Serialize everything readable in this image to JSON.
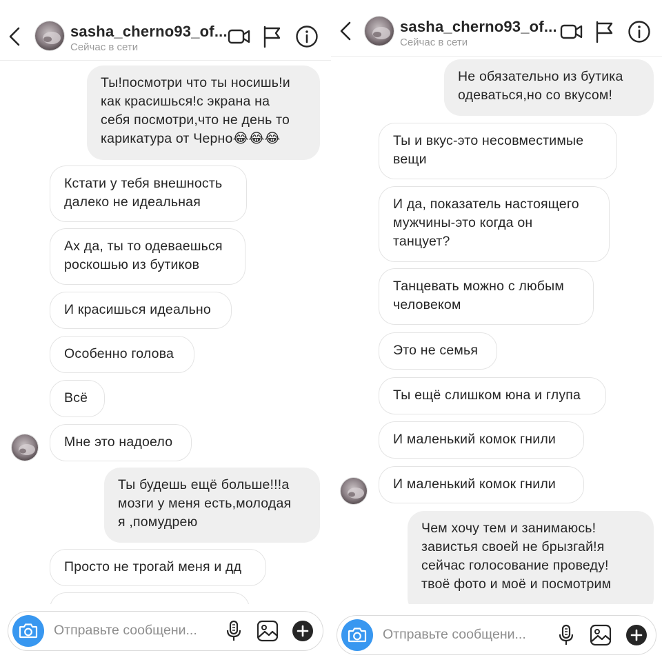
{
  "left": {
    "header": {
      "name": "sasha_cherno93_of...",
      "status": "Сейчас в сети"
    },
    "messages": [
      {
        "dir": "out",
        "text": "Ты!посмотри что ты носишь!и\nкак красишься!с экрана на\nсебя посмотри,что не день то\nкарикатура от Черно😂😂😂"
      },
      {
        "dir": "in",
        "text": "Кстати у тебя внешность\nдалеко не идеальная"
      },
      {
        "dir": "in",
        "text": "Ах да, ты то одеваешься\nроскошью из бутиков"
      },
      {
        "dir": "in",
        "text": "И красишься идеально"
      },
      {
        "dir": "in",
        "text": "Особенно голова"
      },
      {
        "dir": "in",
        "text": "Всё"
      },
      {
        "dir": "in",
        "text": "Мне это надоело"
      },
      {
        "dir": "out",
        "text": "Ты будешь ещё больше!!!а\nмозги у меня есть,молодая\nя ,помудрею"
      },
      {
        "dir": "in",
        "text": "Просто не трогай меня и дд"
      }
    ],
    "composer": {
      "placeholder": "Отправьте сообщени..."
    }
  },
  "right": {
    "header": {
      "name": "sasha_cherno93_of...",
      "status": "Сейчас в сети"
    },
    "messages": [
      {
        "dir": "out",
        "text": "Не обязательно из бутика\nодеваться,но со вкусом!"
      },
      {
        "dir": "in",
        "text": "Ты и вкус-это несовместимые\nвещи"
      },
      {
        "dir": "in",
        "text": "И да, показатель настоящего\nмужчины-это когда он\nтанцует?"
      },
      {
        "dir": "in",
        "text": "Танцевать можно с любым\nчеловеком"
      },
      {
        "dir": "in",
        "text": "Это не семья"
      },
      {
        "dir": "in",
        "text": "Ты ещё слишком юна и глупа"
      },
      {
        "dir": "in",
        "text": "И маленький комок гнили"
      },
      {
        "dir": "in",
        "text": "И маленький комок гнили"
      },
      {
        "dir": "out",
        "text": "Чем хочу тем и занимаюсь!\nзавистья своей не брызгай!я\nсейчас голосование проведу!\nтвоё фото и моё и посмотрим"
      }
    ],
    "composer": {
      "placeholder": "Отправьте сообщени..."
    }
  },
  "icons": {
    "back": "chevron-left-icon",
    "video": "video-camera-icon",
    "flag": "flag-icon",
    "info": "info-icon",
    "camera": "camera-icon",
    "mic": "microphone-icon",
    "gallery": "image-gallery-icon",
    "plus": "plus-icon"
  },
  "colors": {
    "accent": "#3897f0",
    "outgoing_bubble": "#efefef",
    "incoming_border": "#e4e4e4",
    "muted_text": "#8e8e8e"
  }
}
